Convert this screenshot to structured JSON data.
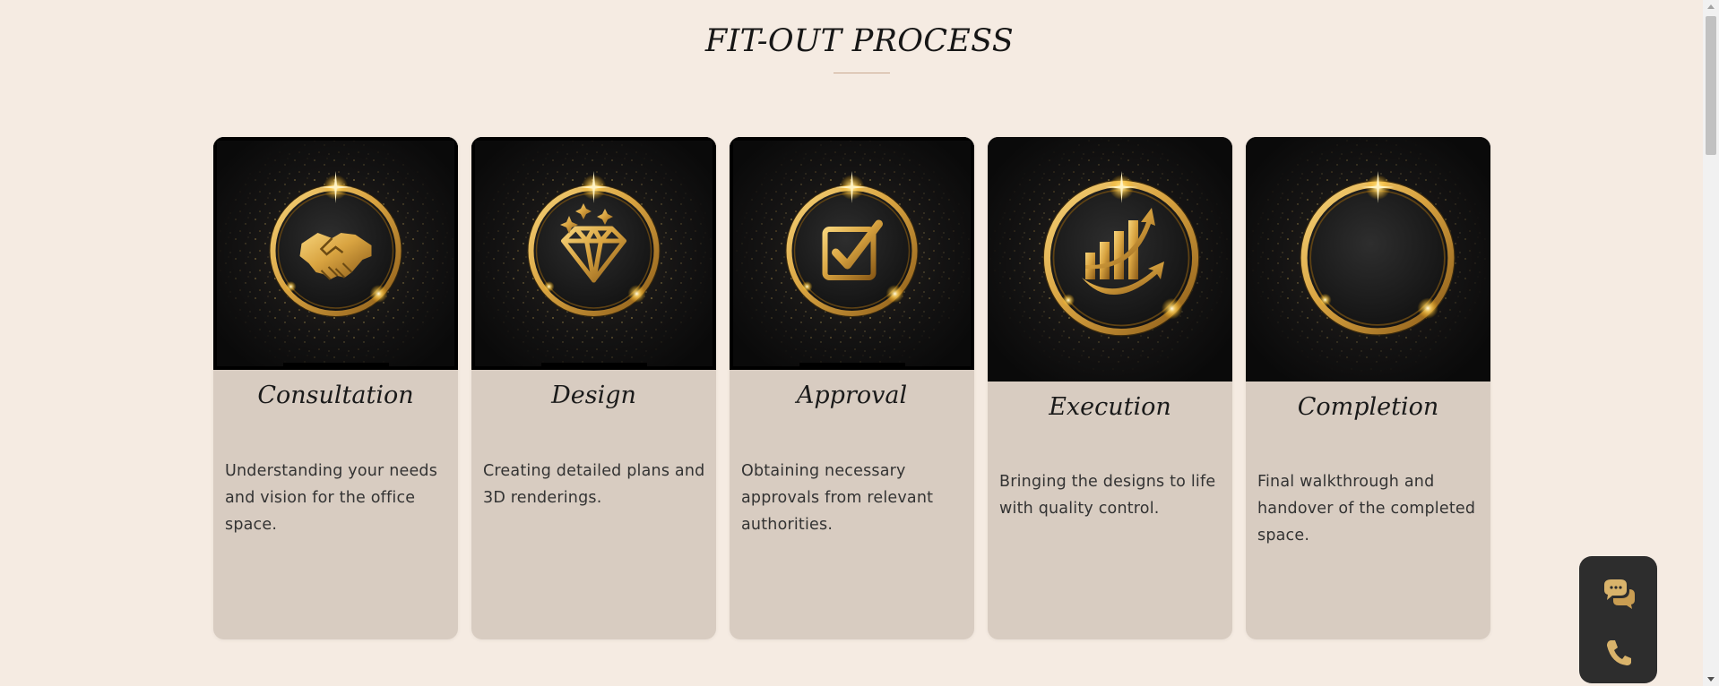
{
  "section": {
    "title": "FIT-OUT PROCESS"
  },
  "steps": [
    {
      "title": "Consultation",
      "description": "Understanding your needs and vision for the office space.",
      "icon": "handshake-icon"
    },
    {
      "title": "Design",
      "description": "Creating detailed plans and 3D renderings.",
      "icon": "diamond-icon"
    },
    {
      "title": "Approval",
      "description": "Obtaining necessary approvals from relevant authorities.",
      "icon": "checkbox-icon"
    },
    {
      "title": "Execution",
      "description": "Bringing the designs to life with quality control.",
      "icon": "growth-chart-icon"
    },
    {
      "title": "Completion",
      "description": "Final walkthrough and handover of the completed space.",
      "icon": "empty-ring-icon"
    }
  ],
  "floating_widget": {
    "chat_icon": "chat-bubbles-icon",
    "phone_icon": "phone-icon"
  },
  "colors": {
    "page_background": "#f5ebe2",
    "card_background": "#d8ccc1",
    "gold": "#d9a441",
    "widget_background": "#2d2d2d"
  }
}
